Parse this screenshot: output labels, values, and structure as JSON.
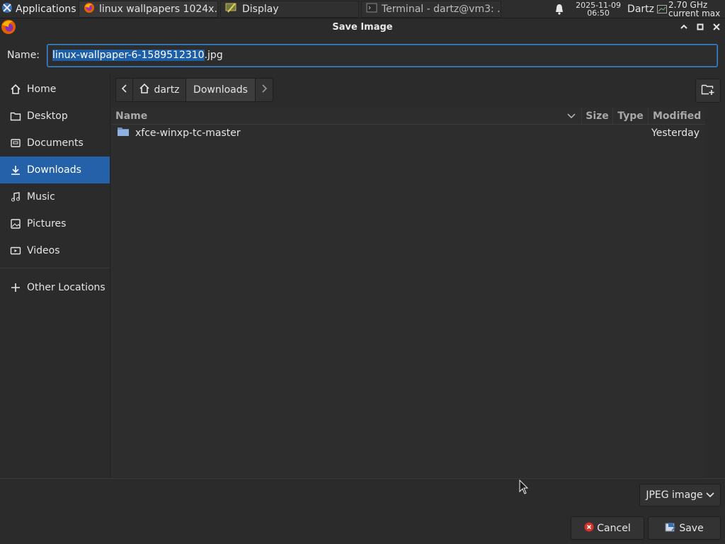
{
  "taskbar": {
    "applications_label": "Applications",
    "tasks": [
      {
        "label": "linux wallpapers 1024x...",
        "icon": "firefox-icon"
      },
      {
        "label": "Display",
        "icon": "display-settings-icon"
      },
      {
        "label": "Terminal - dartz@vm3: ...",
        "icon": "terminal-icon"
      }
    ],
    "clock_date": "2025-11-09",
    "clock_time": "06:50",
    "user": "Dartz",
    "cpu_line1": "2.70 GHz",
    "cpu_line2": "current max"
  },
  "dialog": {
    "title": "Save Image",
    "name_label": "Name:",
    "filename_selected": "linux-wallpaper-6-1589512310",
    "filename_ext": ".jpg"
  },
  "sidebar": {
    "items": [
      {
        "label": "Home",
        "icon": "home-icon"
      },
      {
        "label": "Desktop",
        "icon": "desktop-folder-icon"
      },
      {
        "label": "Documents",
        "icon": "documents-icon"
      },
      {
        "label": "Downloads",
        "icon": "download-icon",
        "active": true
      },
      {
        "label": "Music",
        "icon": "music-icon"
      },
      {
        "label": "Pictures",
        "icon": "pictures-icon"
      },
      {
        "label": "Videos",
        "icon": "videos-icon"
      }
    ],
    "other_locations": "Other Locations"
  },
  "pathbar": {
    "home": "dartz",
    "current": "Downloads"
  },
  "filelist": {
    "columns": {
      "name": "Name",
      "size": "Size",
      "type": "Type",
      "modified": "Modified"
    },
    "rows": [
      {
        "name": "xfce-winxp-tc-master",
        "size": "",
        "type": "",
        "modified": "Yesterday",
        "icon": "folder-icon"
      }
    ]
  },
  "footer": {
    "filter": "JPEG image",
    "cancel": "Cancel",
    "save": "Save"
  },
  "colors": {
    "accent": "#2461a8",
    "selection": "#1c5fa8",
    "background": "#2b2b2b"
  }
}
